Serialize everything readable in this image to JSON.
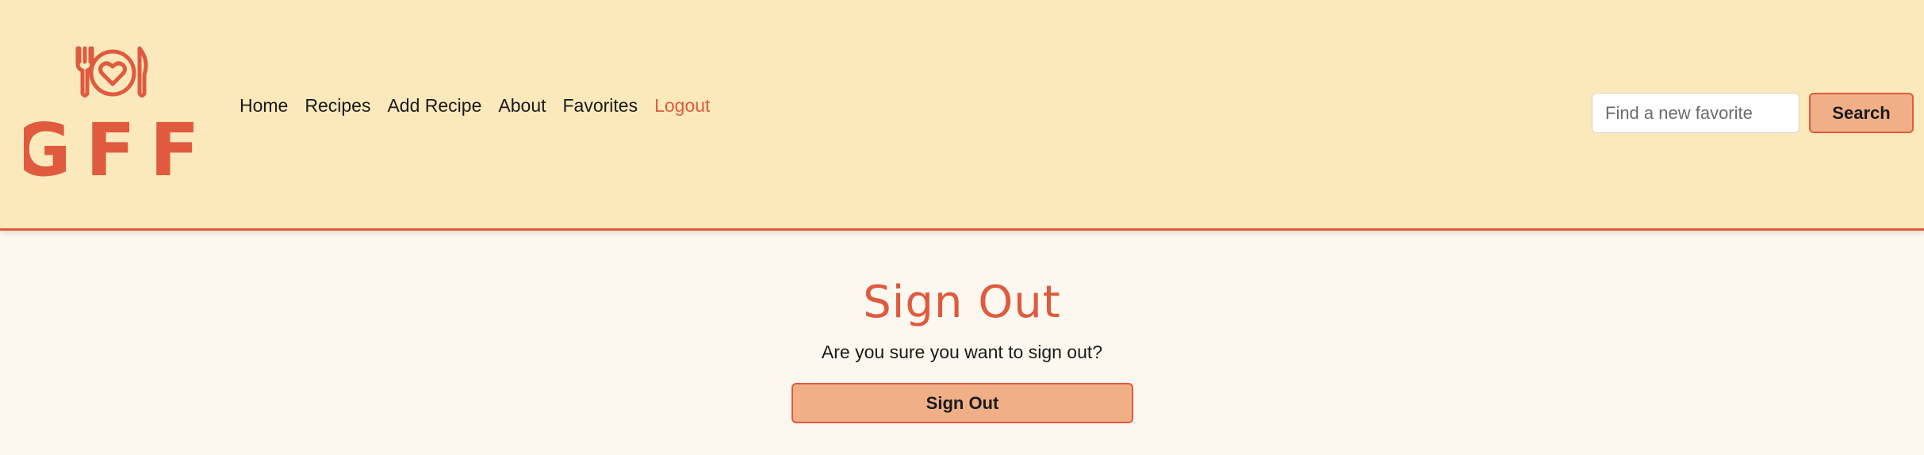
{
  "header": {
    "logo": {
      "text": "GFF",
      "icon": "plate-fork-knife-heart-icon",
      "color": "#e05a3f"
    },
    "nav": {
      "items": [
        {
          "label": "Home",
          "active": false
        },
        {
          "label": "Recipes",
          "active": false
        },
        {
          "label": "Add Recipe",
          "active": false
        },
        {
          "label": "About",
          "active": false
        },
        {
          "label": "Favorites",
          "active": false
        },
        {
          "label": "Logout",
          "active": true
        }
      ]
    },
    "search": {
      "placeholder": "Find a new favorite",
      "value": "",
      "button_label": "Search"
    },
    "background_color": "#fbe9bb",
    "accent_color": "#e05a3f"
  },
  "main": {
    "title": "Sign Out",
    "prompt": "Are you sure you want to sign out?",
    "button_label": "Sign Out",
    "button_color": "#f0af87"
  }
}
